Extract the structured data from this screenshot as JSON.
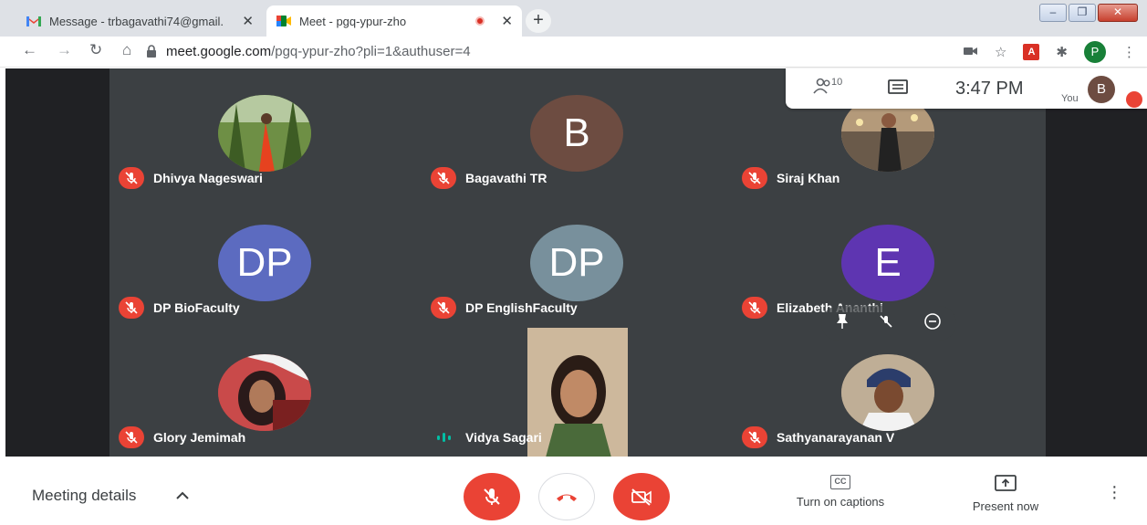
{
  "browser": {
    "tabs": [
      {
        "title": "Message - trbagavathi74@gmail.",
        "close": "✕"
      },
      {
        "title": "Meet - pgq-ypur-zho",
        "close": "✕"
      }
    ],
    "new_tab": "+",
    "url_host": "meet.google.com",
    "url_rest": "/pgq-ypur-zho?pli=1&authuser=4",
    "profile_initial": "P",
    "pdf_label": "A"
  },
  "panel": {
    "people_count": "10",
    "time": "3:47 PM",
    "you_label": "You",
    "self_initial": "B"
  },
  "participants": [
    {
      "name": "Dhivya Nageswari",
      "initial": "",
      "color": "#5b7d3a"
    },
    {
      "name": "Bagavathi TR",
      "initial": "B",
      "color": "#6d4c41"
    },
    {
      "name": "Siraj Khan",
      "initial": "",
      "color": "#8a6b5a"
    },
    {
      "name": "DP BioFaculty",
      "initial": "DP",
      "color": "#5c6bc0"
    },
    {
      "name": "DP EnglishFaculty",
      "initial": "DP",
      "color": "#78909c"
    },
    {
      "name": "Elizabeth Ananthi",
      "initial": "E",
      "color": "#5e35b1"
    },
    {
      "name": "Glory Jemimah",
      "initial": "",
      "color": "#a33a3a"
    },
    {
      "name": "Vidya Sagari",
      "initial": "",
      "color": "#6b5a4a"
    },
    {
      "name": "Sathyanarayanan V",
      "initial": "",
      "color": "#8c7a66"
    }
  ],
  "bottom": {
    "meeting_details": "Meeting details",
    "captions_label": "Turn on captions",
    "captions_icon": "CC",
    "present_label": "Present now"
  }
}
